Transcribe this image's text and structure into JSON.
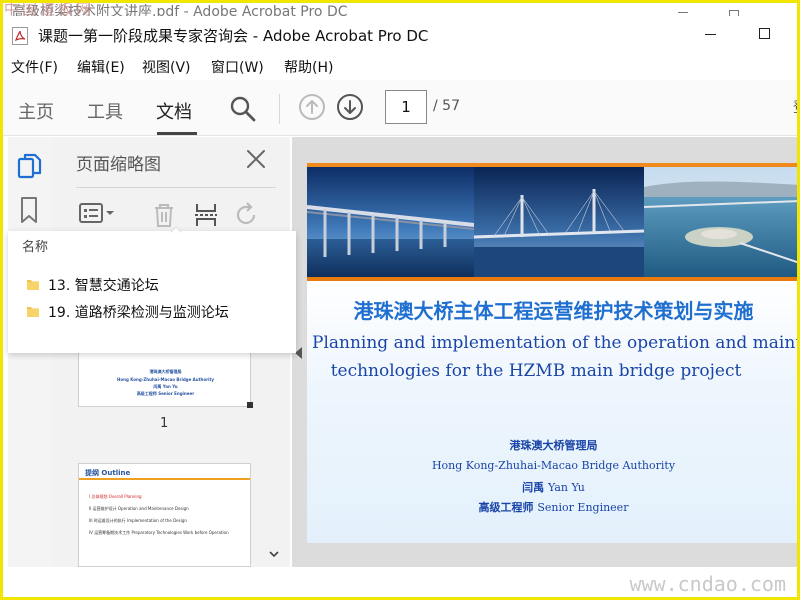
{
  "watermark": {
    "top": "中国道板网",
    "bottom": "www.cndao.com"
  },
  "ghost_window_title": "高级桥梁技术附文讲座.pdf - Adobe Acrobat Pro DC",
  "window": {
    "title": "课题一第一阶段成果专家咨询会 - Adobe Acrobat Pro DC"
  },
  "menu": [
    "文件(F)",
    "编辑(E)",
    "视图(V)",
    "窗口(W)",
    "帮助(H)"
  ],
  "toolbar": {
    "tabs": [
      "主页",
      "工具",
      "文档"
    ],
    "active_tab": "文档",
    "page_current": "1",
    "page_total": "/ 57",
    "edge_glyph": "登"
  },
  "left_rail": {
    "icons": [
      "page-thumbnails-icon",
      "bookmark-icon"
    ]
  },
  "thumbnail_panel": {
    "title": "页面缩略图",
    "tools": [
      "options-menu-icon",
      "delete-icon",
      "extract-icon",
      "rotate-icon"
    ],
    "thumb1": {
      "lines": [
        "港珠澳大桥管理局",
        "Hong Kong-Zhuhai-Macao Bridge Authority",
        "闫禹 Yan Yu",
        "高级工程师 Senior Engineer"
      ],
      "page_label": "1"
    },
    "thumb2": {
      "heading": "提纲 Outline",
      "items": [
        "I  总体规划  Overall Planning",
        "II  运营维护设计  Operation and Maintenance Design",
        "III  时运维设计的执行  Implementation of the Design",
        "IV  运营筹备期技术工作  Preparatory Technologies Work before Operation"
      ]
    }
  },
  "flyout": {
    "header": "名称",
    "items": [
      "13. 智慧交通论坛",
      "19. 道路桥梁检测与监测论坛"
    ]
  },
  "slide": {
    "title_cn": "港珠澳大桥主体工程运营维护技术策划与实施",
    "title_en_line1": "Planning and implementation of the operation and maintenance",
    "title_en_line2": "technologies for the HZMB main bridge project",
    "org_cn": "港珠澳大桥管理局",
    "org_en": "Hong Kong-Zhuhai-Macao Bridge Authority",
    "author_cn": "闫禹",
    "author_en": "Yan Yu",
    "role_cn": "高级工程师",
    "role_en": "Senior Engineer"
  },
  "colors": {
    "accent_orange": "#e87b10",
    "title_blue": "#1f6fd0",
    "text_blue": "#1a45a8",
    "frame_yellow": "#f2e600"
  }
}
